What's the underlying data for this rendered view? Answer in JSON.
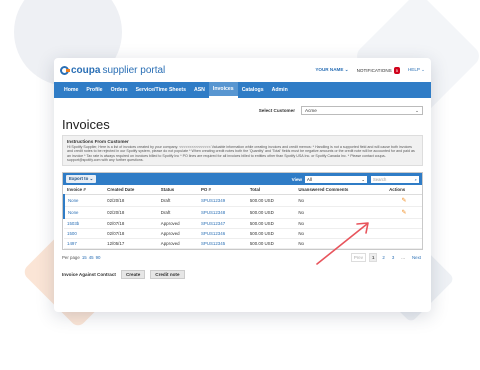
{
  "header": {
    "brand": "coupa",
    "brand_sub": "supplier portal",
    "user": "YOUR NAME",
    "notifications_label": "NOTIFICATIONS",
    "notifications_count": "5",
    "help": "HELP"
  },
  "nav": {
    "items": [
      "Home",
      "Profile",
      "Orders",
      "Service/Time Sheets",
      "ASN",
      "Invoices",
      "Catalogs",
      "Admin"
    ],
    "active": "Invoices"
  },
  "customer": {
    "label": "Select Customer",
    "value": "Acme"
  },
  "page_title": "Invoices",
  "instructions": {
    "title": "Instructions From Customer",
    "text": "Hi Spotify Supplier, Here is a list of invoices created by your company. <<<<<<<<<<<<<<< Valuable information while creating invoices and credit memos: * Handling is not a supported field and will cause both invoices and credit notes to be rejected in our Spotify system, please do not populate * When creating credit notes both the 'Quantity' and 'Total' fields must be negative amounts or the credit note will be accounted for and paid as an invoice * Tax rate is always required on invoices billed to Spotify Inc * PO lines are required for all invoices billed to entities other than Spotify USA Inc. or Spotify Canada Inc. * Please contact coupa-support@spotify.com with any further questions."
  },
  "table": {
    "export_label": "Export to",
    "view_label": "View",
    "view_value": "All",
    "search_placeholder": "Search",
    "columns": [
      "Invoice #",
      "Created Date",
      "Status",
      "PO #",
      "Total",
      "Unanswered Comments",
      "Actions"
    ],
    "rows": [
      {
        "invoice": "None",
        "date": "02/20/18",
        "status": "Draft",
        "po": "SPUS12349",
        "total": "500.00 USD",
        "comments": "No",
        "action": "edit"
      },
      {
        "invoice": "None",
        "date": "02/20/18",
        "status": "Draft",
        "po": "SPUS12348",
        "total": "500.00 USD",
        "comments": "No",
        "action": "edit"
      },
      {
        "invoice": "1503b",
        "date": "02/07/18",
        "status": "Approved",
        "po": "SPUS12347",
        "total": "500.00 USD",
        "comments": "No",
        "action": ""
      },
      {
        "invoice": "1500",
        "date": "02/07/18",
        "status": "Approved",
        "po": "SPUS12346",
        "total": "500.00 USD",
        "comments": "No",
        "action": ""
      },
      {
        "invoice": "1497",
        "date": "12/05/17",
        "status": "Approved",
        "po": "SPUS12345",
        "total": "500.00 USD",
        "comments": "No",
        "action": ""
      }
    ]
  },
  "pager": {
    "per_page_label": "Per page",
    "per_page_options": [
      "15",
      "45",
      "90"
    ],
    "prev": "Prev",
    "pages": [
      "1",
      "2",
      "3",
      "..."
    ],
    "next": "Next"
  },
  "bottom": {
    "label": "Invoice Against Contract",
    "create": "Create",
    "credit_note": "Credit note"
  },
  "colors": {
    "primary": "#2f7cc6",
    "accent": "#f08a1c",
    "arrow": "#e8545c"
  }
}
